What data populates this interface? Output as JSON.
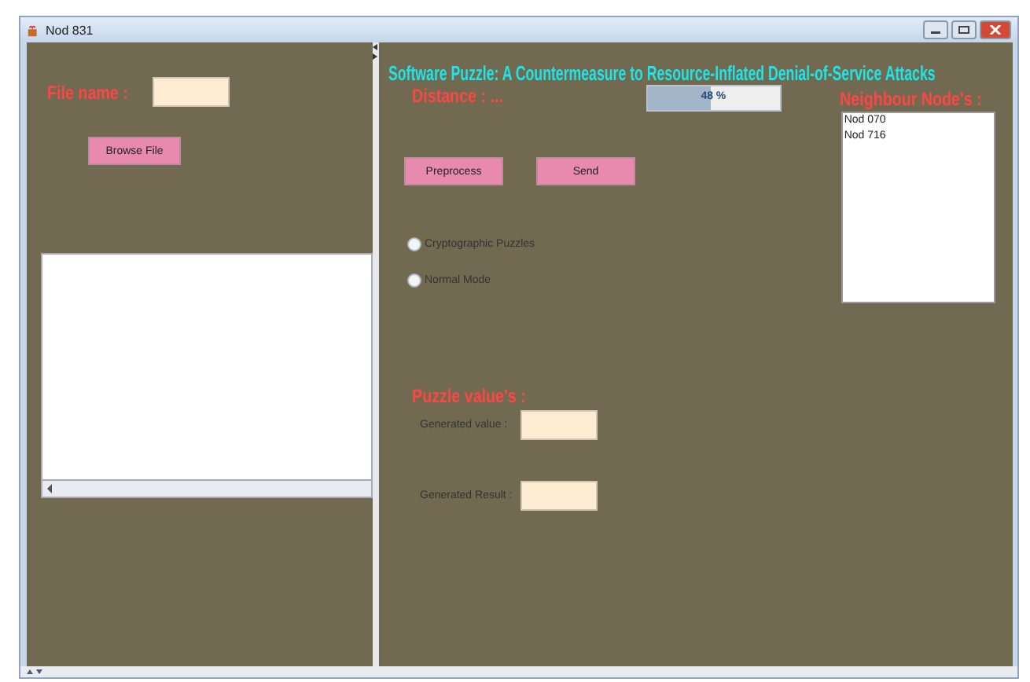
{
  "window": {
    "title": "Nod 831"
  },
  "file_panel": {
    "label": "File name :",
    "browse_button": "Browse File"
  },
  "main": {
    "title": "Software Puzzle: A Countermeasure to Resource-Inflated Denial-of-Service Attacks",
    "distance_label": "Distance : ...",
    "progress": {
      "level": 0.48,
      "reading": "48 %"
    },
    "buttons": [
      "Preprocess",
      "Send"
    ],
    "modes": [
      {
        "label": "Cryptographic Puzzles",
        "selected": false
      },
      {
        "label": "Normal Mode",
        "selected": false
      }
    ],
    "puzzle": {
      "heading": "Puzzle value's :",
      "fields": [
        {
          "label": "Generated value :"
        },
        {
          "label": "Generated Result :"
        }
      ]
    }
  },
  "neighbours": {
    "heading": "Neighbour Node's :",
    "items": [
      "Nod 070",
      "Nod 716"
    ]
  }
}
